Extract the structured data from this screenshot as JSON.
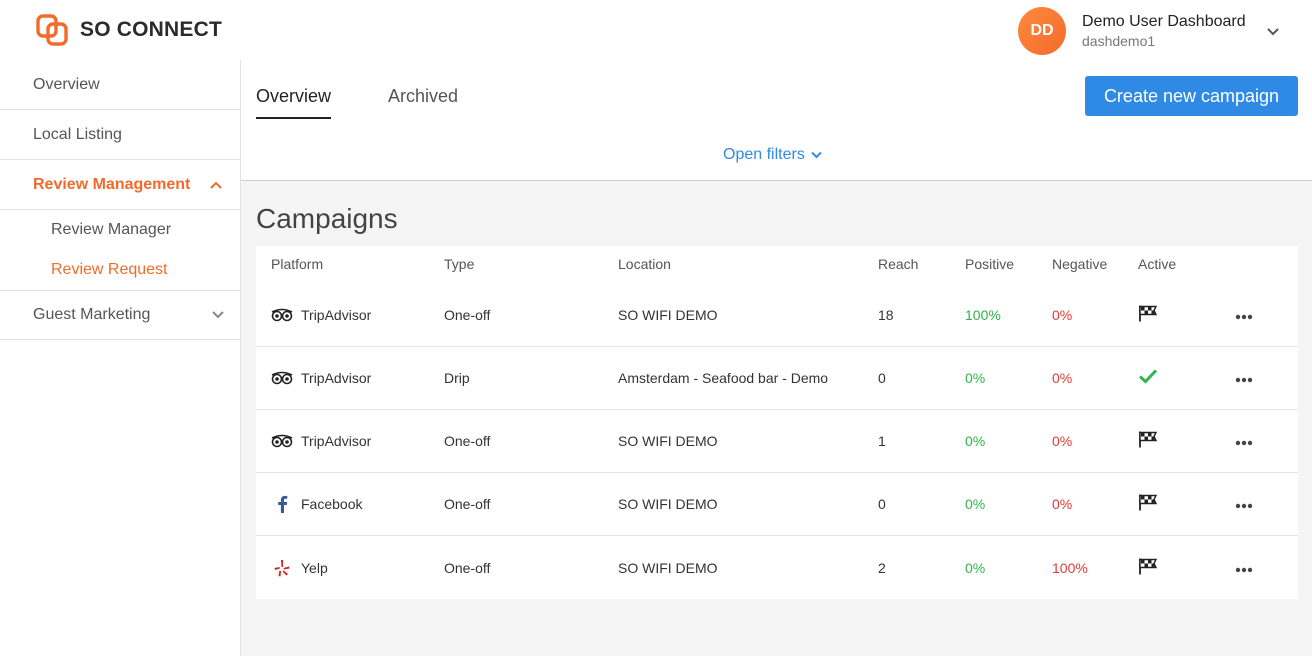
{
  "brand": {
    "name": "SO CONNECT",
    "accent": "#f26b2b",
    "primary": "#2f8ae5"
  },
  "user": {
    "initials": "DD",
    "name": "Demo User Dashboard",
    "username": "dashdemo1"
  },
  "sidebar": {
    "items": [
      {
        "label": "Overview"
      },
      {
        "label": "Local Listing"
      },
      {
        "label": "Review Management",
        "active": true
      },
      {
        "label": "Guest Marketing"
      }
    ],
    "sub_items": [
      {
        "label": "Review Manager"
      },
      {
        "label": "Review Request",
        "active": true
      }
    ]
  },
  "tabs": [
    {
      "label": "Overview",
      "active": true
    },
    {
      "label": "Archived"
    }
  ],
  "create_button": "Create new campaign",
  "filters_label": "Open filters",
  "campaigns": {
    "title": "Campaigns",
    "columns": [
      "Platform",
      "Type",
      "Location",
      "Reach",
      "Positive",
      "Negative",
      "Active"
    ],
    "rows": [
      {
        "platform": "TripAdvisor",
        "icon": "tripadvisor-icon",
        "type": "One-off",
        "location": "SO WIFI DEMO",
        "reach": "18",
        "positive": "100%",
        "negative": "0%",
        "active": "checkered-flag-icon"
      },
      {
        "platform": "TripAdvisor",
        "icon": "tripadvisor-icon",
        "type": "Drip",
        "location": "Amsterdam - Seafood bar - Demo",
        "reach": "0",
        "positive": "0%",
        "negative": "0%",
        "active": "checkmark-icon"
      },
      {
        "platform": "TripAdvisor",
        "icon": "tripadvisor-icon",
        "type": "One-off",
        "location": "SO WIFI DEMO",
        "reach": "1",
        "positive": "0%",
        "negative": "0%",
        "active": "checkered-flag-icon"
      },
      {
        "platform": "Facebook",
        "icon": "facebook-icon",
        "type": "One-off",
        "location": "SO WIFI DEMO",
        "reach": "0",
        "positive": "0%",
        "negative": "0%",
        "active": "checkered-flag-icon"
      },
      {
        "platform": "Yelp",
        "icon": "yelp-icon",
        "type": "One-off",
        "location": "SO WIFI DEMO",
        "reach": "2",
        "positive": "0%",
        "negative": "100%",
        "active": "checkered-flag-icon"
      }
    ]
  }
}
